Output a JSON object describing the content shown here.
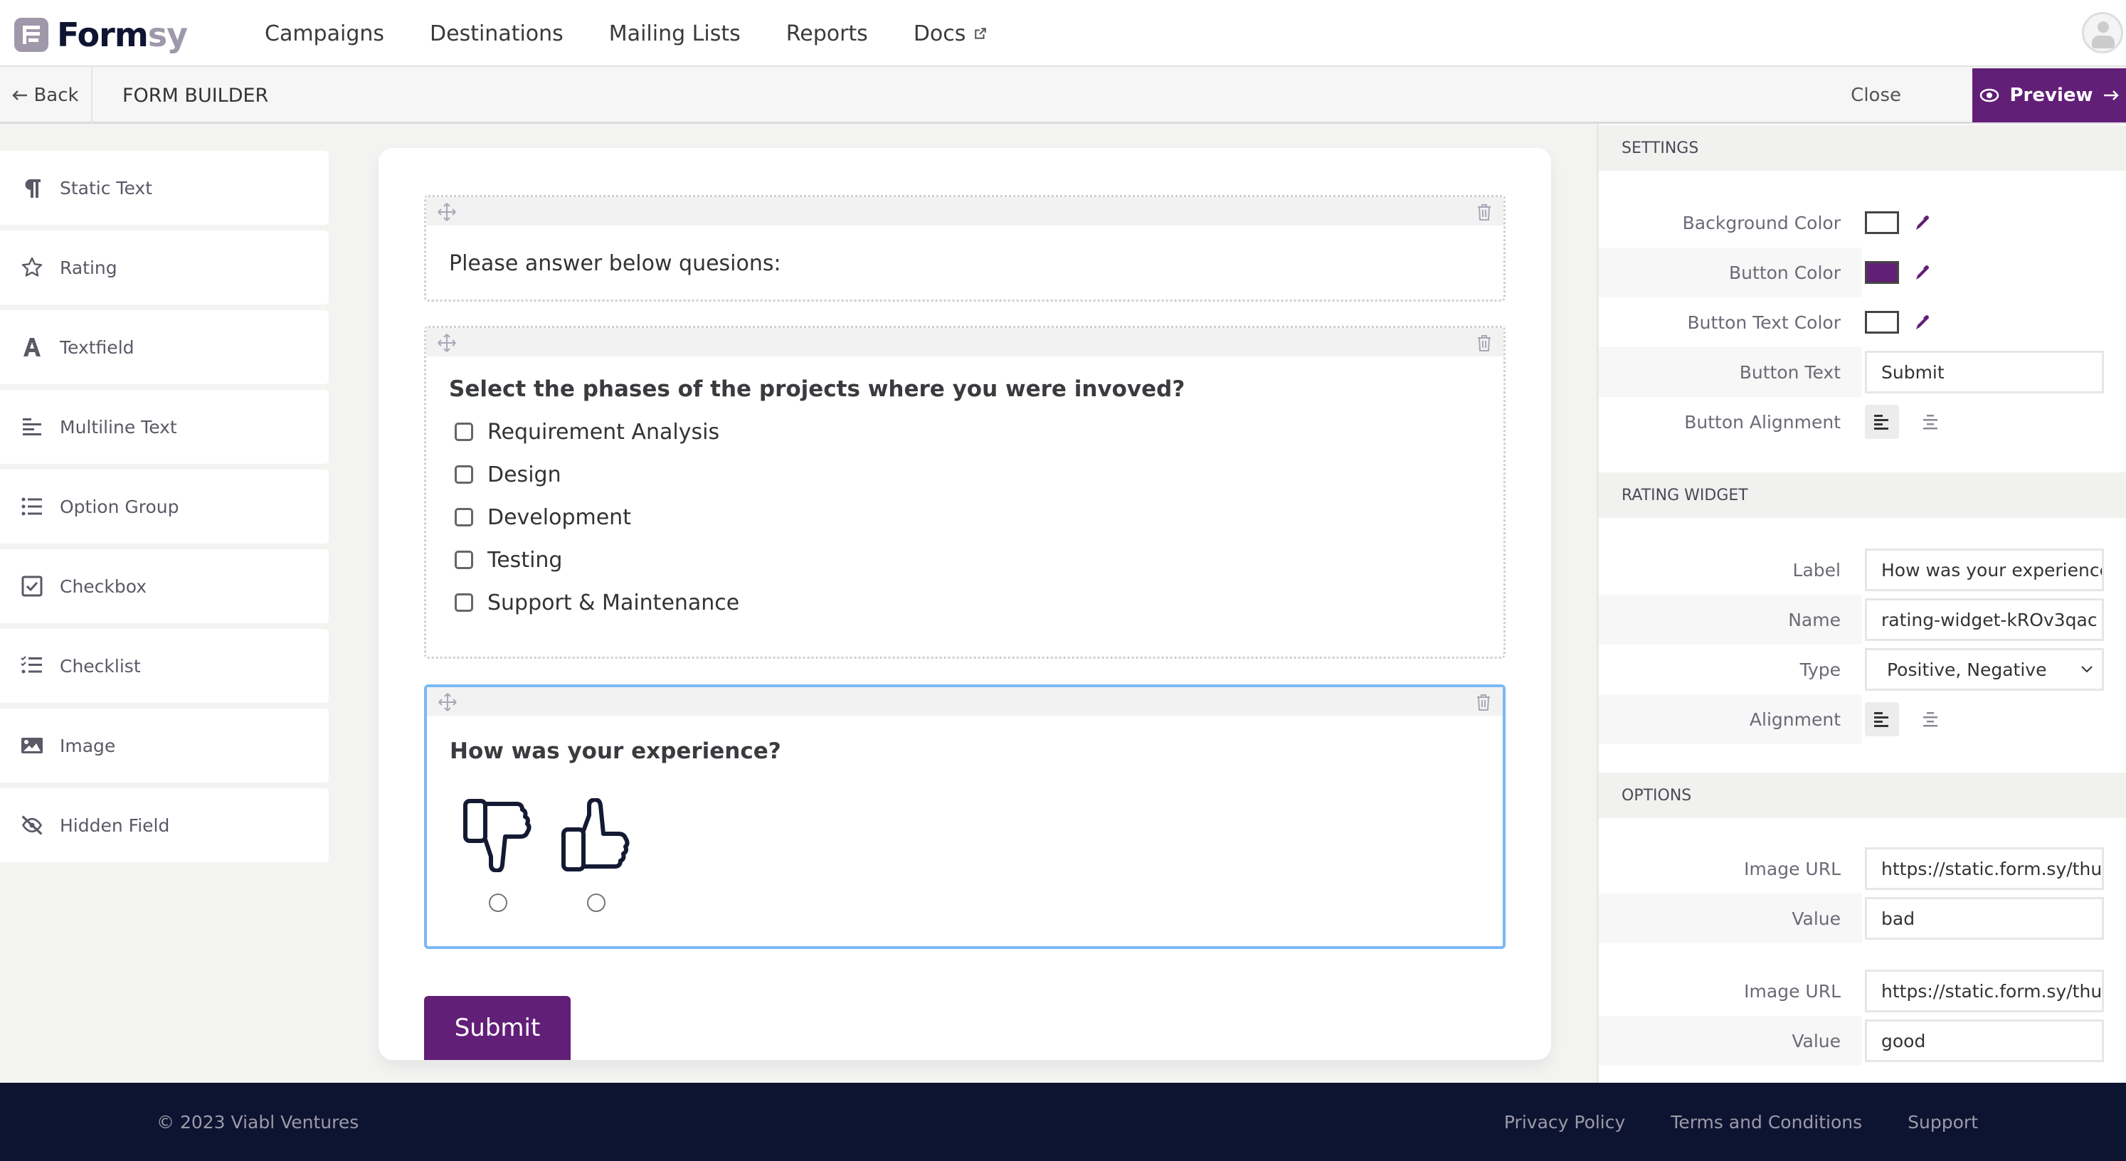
{
  "brand": {
    "name_part1": "Form",
    "name_part2": "sy"
  },
  "topnav": {
    "links": [
      {
        "label": "Campaigns"
      },
      {
        "label": "Destinations"
      },
      {
        "label": "Mailing Lists"
      },
      {
        "label": "Reports"
      },
      {
        "label": "Docs",
        "icon": "external-link-icon"
      }
    ],
    "avatar_icon": "user-avatar-icon"
  },
  "subheader": {
    "back_label": "Back",
    "title": "FORM BUILDER",
    "close_label": "Close",
    "preview_label": "Preview"
  },
  "sidebar": {
    "items": [
      {
        "label": "Static Text",
        "icon": "paragraph-icon"
      },
      {
        "label": "Rating",
        "icon": "star-icon"
      },
      {
        "label": "Textfield",
        "icon": "letter-a-icon"
      },
      {
        "label": "Multiline Text",
        "icon": "multiline-icon"
      },
      {
        "label": "Option Group",
        "icon": "list-icon"
      },
      {
        "label": "Checkbox",
        "icon": "checkbox-icon"
      },
      {
        "label": "Checklist",
        "icon": "checklist-icon"
      },
      {
        "label": "Image",
        "icon": "image-icon"
      },
      {
        "label": "Hidden Field",
        "icon": "eye-slash-icon"
      }
    ]
  },
  "form": {
    "static_text": "Please answer below quesions:",
    "checklist": {
      "label": "Select the phases of the projects where you were invoved?",
      "options": [
        "Requirement Analysis",
        "Design",
        "Development",
        "Testing",
        "Support & Maintenance"
      ]
    },
    "rating": {
      "label": "How was your experience?",
      "options": [
        {
          "icon": "thumbs-down-icon",
          "value": "bad"
        },
        {
          "icon": "thumbs-up-icon",
          "value": "good"
        }
      ]
    },
    "submit_label": "Submit"
  },
  "settings": {
    "title": "SETTINGS",
    "background_color_label": "Background Color",
    "background_color": "#ffffff",
    "button_color_label": "Button Color",
    "button_color": "#621f77",
    "button_text_color_label": "Button Text Color",
    "button_text_color": "#ffffff",
    "button_text_label": "Button Text",
    "button_text": "Submit",
    "button_alignment_label": "Button Alignment",
    "button_alignment": "left"
  },
  "rating_widget": {
    "title": "RATING WIDGET",
    "label_label": "Label",
    "label_value": "How was your experience?",
    "name_label": "Name",
    "name_value": "rating-widget-kROv3qac",
    "type_label": "Type",
    "type_value": "Positive, Negative",
    "alignment_label": "Alignment",
    "alignment": "left"
  },
  "options": {
    "title": "OPTIONS",
    "items": [
      {
        "image_url_label": "Image URL",
        "image_url": "https://static.form.sy/thu",
        "value_label": "Value",
        "value": "bad"
      },
      {
        "image_url_label": "Image URL",
        "image_url": "https://static.form.sy/thu",
        "value_label": "Value",
        "value": "good"
      }
    ]
  },
  "footer": {
    "copyright": "© 2023 Viabl Ventures",
    "links": [
      "Privacy Policy",
      "Terms and Conditions",
      "Support"
    ]
  },
  "colors": {
    "accent": "#621f77",
    "footer_bg": "#0d1431",
    "selected_border": "#7ab8f5"
  }
}
